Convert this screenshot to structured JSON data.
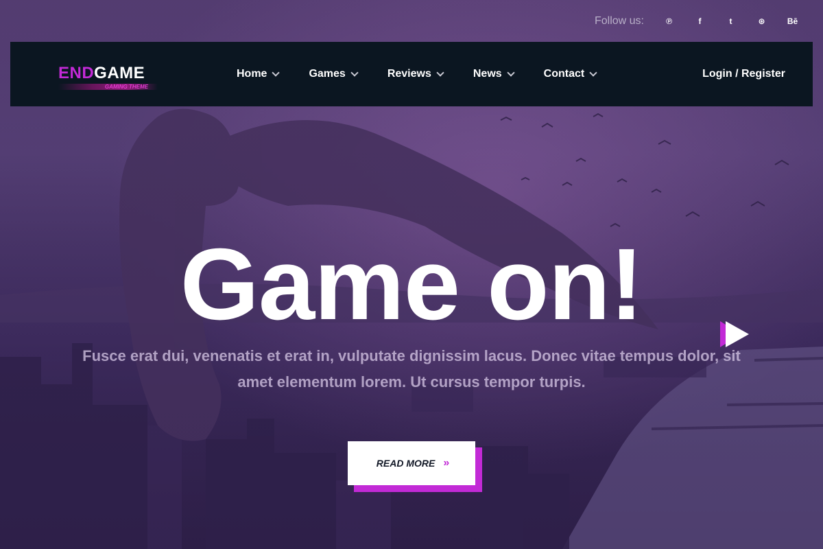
{
  "social": {
    "follow_label": "Follow us:",
    "icons": [
      {
        "name": "pinterest",
        "glyph": "℗"
      },
      {
        "name": "facebook",
        "glyph": "f"
      },
      {
        "name": "twitter",
        "glyph": "t"
      },
      {
        "name": "dribbble",
        "glyph": "⊛"
      },
      {
        "name": "behance",
        "glyph": "Bē"
      }
    ]
  },
  "logo": {
    "part1": "END",
    "part2": "GAME",
    "tagline": "GAMING THEME"
  },
  "nav": {
    "items": [
      "Home",
      "Games",
      "Reviews",
      "News",
      "Contact"
    ],
    "login": "Login / Register"
  },
  "hero": {
    "title": "Game on!",
    "subtitle": "Fusce erat dui, venenatis et erat in, vulputate dignissim lacus. Donec vitae tempus dolor, sit amet elementum lorem. Ut cursus tempor turpis.",
    "cta_label": "READ MORE",
    "cta_arrow": "»"
  },
  "colors": {
    "accent": "#c22ad6",
    "navbar": "#0b1621",
    "text": "#ffffff"
  }
}
